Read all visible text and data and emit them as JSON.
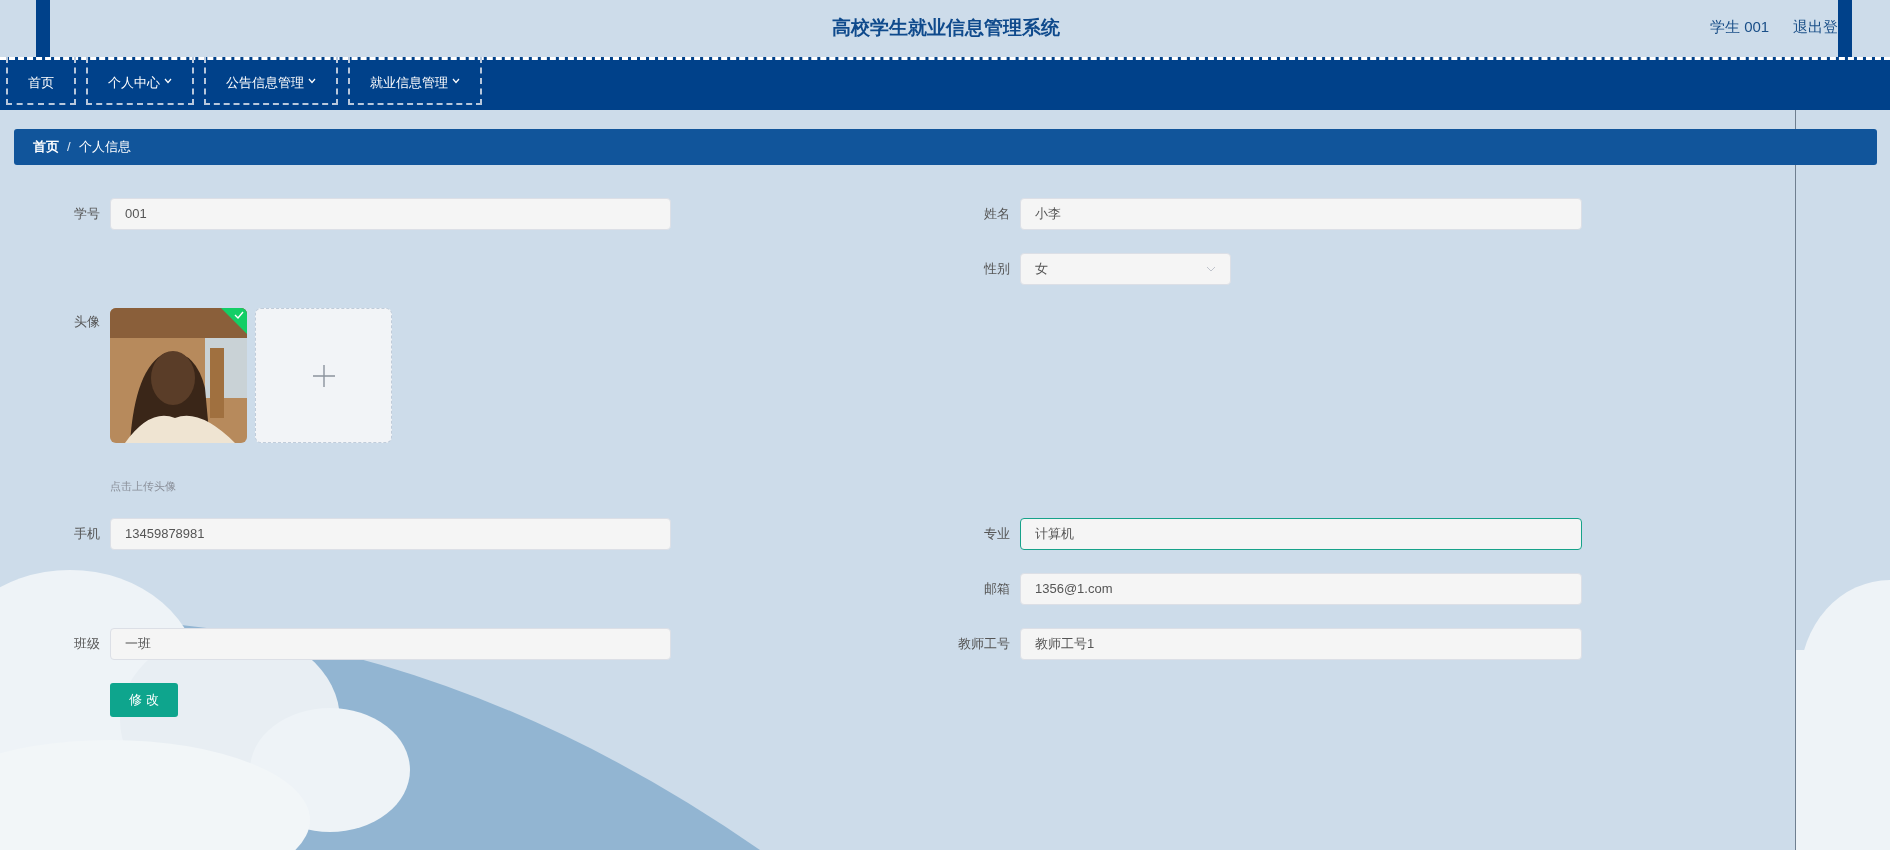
{
  "header": {
    "title": "高校学生就业信息管理系统",
    "user": "学生 001",
    "logout": "退出登"
  },
  "nav": [
    {
      "label": "首页",
      "dropdown": false
    },
    {
      "label": "个人中心",
      "dropdown": true
    },
    {
      "label": "公告信息管理",
      "dropdown": true
    },
    {
      "label": "就业信息管理",
      "dropdown": true
    }
  ],
  "breadcrumb": {
    "separator": "/",
    "items": [
      "首页",
      "个人信息"
    ]
  },
  "form": {
    "rows": [
      {
        "left": {
          "kind": "text",
          "label": "学号",
          "value": "001",
          "focused": false
        },
        "right": {
          "kind": "text",
          "label": "姓名",
          "value": "小李",
          "focused": false
        }
      },
      {
        "right": {
          "kind": "select",
          "label": "性别",
          "value": "女",
          "focused": false
        }
      },
      {
        "left": {
          "kind": "upload",
          "label": "头像",
          "uploaded": true,
          "hint": "点击上传头像"
        }
      },
      {
        "left": {
          "kind": "text",
          "label": "手机",
          "value": "13459878981",
          "focused": false
        },
        "right": {
          "kind": "text",
          "label": "专业",
          "value": "计算机",
          "focused": true
        }
      },
      {
        "right": {
          "kind": "text",
          "label": "邮箱",
          "value": "1356@1.com",
          "focused": false
        }
      },
      {
        "left": {
          "kind": "text",
          "label": "班级",
          "value": "一班",
          "focused": false
        },
        "right": {
          "kind": "text",
          "label": "教师工号",
          "value": "教师工号1",
          "focused": false
        }
      }
    ],
    "submit": "修 改"
  }
}
